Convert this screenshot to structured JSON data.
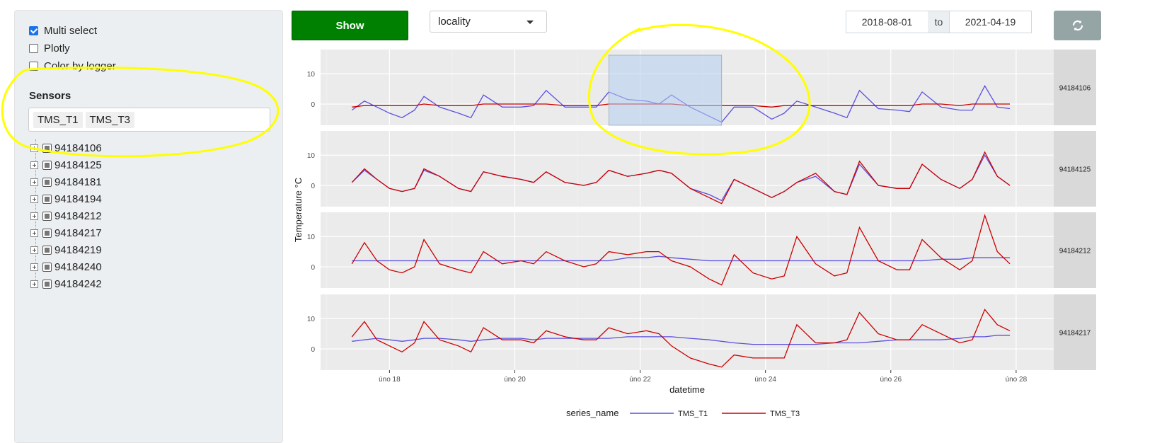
{
  "sidebar": {
    "options": [
      {
        "label": "Multi select",
        "checked": true
      },
      {
        "label": "Plotly",
        "checked": false
      },
      {
        "label": "Color by logger",
        "checked": false
      }
    ],
    "sensors_label": "Sensors",
    "selected_sensors": [
      "TMS_T1",
      "TMS_T3"
    ],
    "tree_items": [
      "94184106",
      "94184125",
      "94184181",
      "94184194",
      "94184212",
      "94184217",
      "94184219",
      "94184240",
      "94184242"
    ]
  },
  "toolbar": {
    "show_label": "Show",
    "group_by_value": "locality",
    "date_from": "2018-08-01",
    "date_separator": "to",
    "date_to": "2021-04-19",
    "refresh_icon": "refresh-icon"
  },
  "colors": {
    "show_button": "#008000",
    "refresh_button": "#95a5a6",
    "panel_bg": "#ebebeb",
    "strip_bg": "#d9d9d9",
    "annotation": "#ffff00"
  },
  "chart_data": {
    "type": "line",
    "xlabel": "datetime",
    "ylabel": "Temperature °C",
    "x_ticks": [
      "úno 18",
      "úno 20",
      "úno 22",
      "úno 24",
      "úno 26",
      "úno 28"
    ],
    "x_tick_values": [
      18,
      20,
      22,
      24,
      26,
      28
    ],
    "xlim": [
      16.9,
      28.6
    ],
    "y_ticks": [
      0,
      10
    ],
    "legend": {
      "title": "series_name",
      "position": "bottom",
      "entries": [
        {
          "name": "TMS_T1",
          "color": "#5b4fe0"
        },
        {
          "name": "TMS_T3",
          "color": "#cc0000"
        }
      ]
    },
    "x": [
      17.4,
      17.6,
      17.8,
      18.0,
      18.2,
      18.4,
      18.55,
      18.8,
      19.1,
      19.3,
      19.5,
      19.8,
      20.1,
      20.3,
      20.5,
      20.8,
      21.1,
      21.3,
      21.5,
      21.8,
      22.1,
      22.3,
      22.5,
      22.8,
      23.1,
      23.3,
      23.5,
      23.8,
      24.1,
      24.3,
      24.5,
      24.8,
      25.1,
      25.3,
      25.5,
      25.8,
      26.1,
      26.3,
      26.5,
      26.8,
      27.1,
      27.3,
      27.5,
      27.7,
      27.9
    ],
    "panels": [
      {
        "name": "94184106",
        "ylim": [
          -7,
          18
        ],
        "series": [
          {
            "name": "TMS_T1",
            "values": [
              -2,
              1,
              -1,
              -3,
              -4.5,
              -2,
              2.5,
              -1,
              -3,
              -4.5,
              3,
              -1,
              -1,
              -0.5,
              4.5,
              -1,
              -1,
              -1,
              4,
              1.5,
              1,
              0,
              3,
              -1,
              -4,
              -6,
              -1,
              -1,
              -5,
              -3,
              1,
              -1,
              -3,
              -4.5,
              4.5,
              -1.5,
              -2,
              -2.5,
              4,
              -1,
              -2,
              -2,
              6,
              -1,
              -1.5
            ]
          },
          {
            "name": "TMS_T3",
            "values": [
              -1,
              -0.5,
              -0.5,
              -0.5,
              -0.5,
              -0.5,
              0,
              -0.5,
              -0.5,
              -0.5,
              0,
              0,
              0,
              0,
              0,
              -0.5,
              -0.5,
              -0.5,
              0,
              0,
              0,
              0,
              0,
              -0.5,
              -0.5,
              -0.5,
              -0.5,
              -0.5,
              -1,
              -0.5,
              -0.5,
              -0.5,
              -0.5,
              -0.5,
              -0.5,
              -0.5,
              -0.5,
              -0.5,
              0,
              0,
              -0.5,
              0,
              0,
              0,
              0
            ]
          }
        ]
      },
      {
        "name": "94184125",
        "ylim": [
          -7,
          18
        ],
        "series": [
          {
            "name": "TMS_T1",
            "values": [
              1,
              5,
              2,
              -1,
              -2,
              -1,
              5,
              3,
              -1,
              -2,
              4.5,
              3,
              2,
              1,
              4.5,
              1,
              0,
              1,
              5,
              3,
              4,
              5,
              4,
              -1,
              -3,
              -5,
              2,
              -1,
              -4,
              -2,
              1,
              3,
              -2,
              -3,
              7,
              0,
              -1,
              -1,
              7,
              2,
              -1,
              2,
              10,
              3,
              0
            ]
          },
          {
            "name": "TMS_T3",
            "values": [
              1,
              5.5,
              2,
              -1,
              -2,
              -1,
              5.5,
              3,
              -1,
              -2,
              4.5,
              3,
              2,
              1,
              4.5,
              1,
              0,
              1,
              5,
              3,
              4,
              5,
              4,
              -1,
              -4,
              -6,
              2,
              -1,
              -4,
              -2,
              1,
              4,
              -2,
              -3,
              8,
              0,
              -1,
              -1,
              7,
              2,
              -1,
              2,
              11,
              3,
              0
            ]
          }
        ]
      },
      {
        "name": "94184212",
        "ylim": [
          -7,
          18
        ],
        "series": [
          {
            "name": "TMS_T1",
            "values": [
              2,
              2,
              2,
              2,
              2,
              2,
              2,
              2,
              2,
              2,
              2,
              2,
              2,
              2,
              2,
              2,
              2,
              2,
              2,
              3,
              3,
              3.5,
              3,
              2.5,
              2,
              2,
              2,
              2,
              2,
              2,
              2,
              2,
              2,
              2,
              2,
              2,
              2,
              2,
              2,
              2.5,
              2.5,
              3,
              3,
              3,
              3
            ]
          },
          {
            "name": "TMS_T3",
            "values": [
              1,
              8,
              2,
              -1,
              -2,
              0,
              9,
              1,
              -1,
              -2,
              5,
              1,
              2,
              1,
              5,
              2,
              0,
              1,
              5,
              4,
              5,
              5,
              2,
              0,
              -4,
              -6,
              4,
              -2,
              -4,
              -3,
              10,
              1,
              -3,
              -2,
              13,
              2,
              -1,
              -1,
              9,
              3,
              -1,
              2,
              17,
              5,
              1
            ]
          }
        ]
      },
      {
        "name": "94184217",
        "ylim": [
          -7,
          18
        ],
        "series": [
          {
            "name": "TMS_T1",
            "values": [
              2.5,
              3,
              3.5,
              3,
              2.5,
              3,
              3.5,
              3.5,
              3,
              2.5,
              3,
              3.5,
              3.5,
              3,
              3.5,
              3.5,
              3.5,
              3.5,
              3.5,
              4,
              4,
              4,
              4,
              3.5,
              3,
              2.5,
              2,
              1.5,
              1.5,
              1.5,
              1.5,
              1.5,
              2,
              2,
              2,
              2.5,
              3,
              3,
              3,
              3,
              3.5,
              4,
              4,
              4.5,
              4.5
            ]
          },
          {
            "name": "TMS_T3",
            "values": [
              4,
              9,
              3,
              1,
              -1,
              2,
              9,
              3,
              1,
              -1,
              7,
              3,
              3,
              2,
              6,
              4,
              3,
              3,
              7,
              5,
              6,
              5,
              1,
              -3,
              -5,
              -6,
              -2,
              -3,
              -3,
              -3,
              8,
              2,
              2,
              3,
              12,
              5,
              3,
              3,
              8,
              5,
              2,
              3,
              13,
              8,
              6
            ]
          }
        ]
      }
    ]
  }
}
